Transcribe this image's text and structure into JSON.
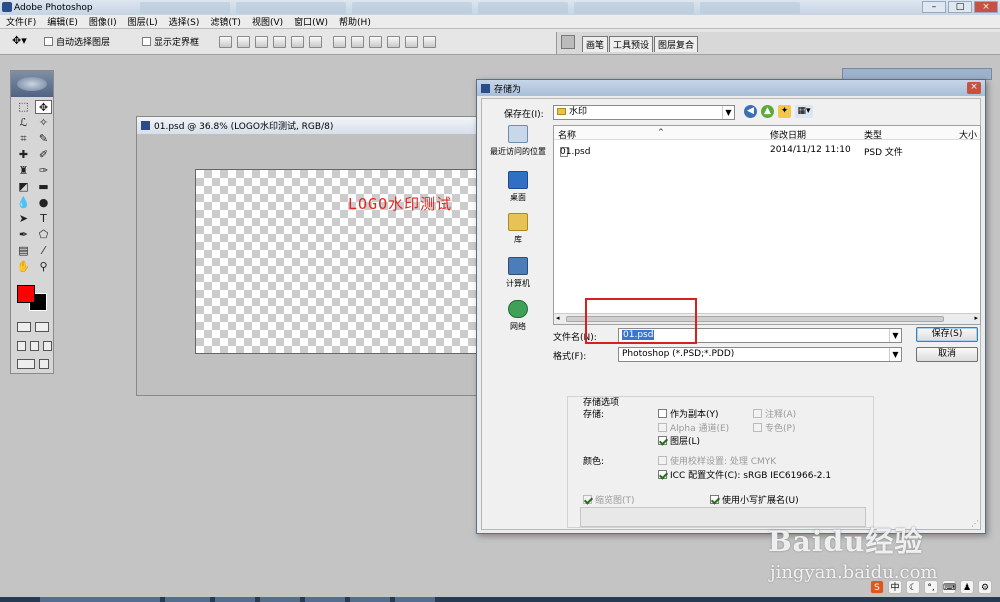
{
  "app": {
    "title": "Adobe Photoshop"
  },
  "menu": [
    "文件(F)",
    "编辑(E)",
    "图像(I)",
    "图层(L)",
    "选择(S)",
    "滤镜(T)",
    "视图(V)",
    "窗口(W)",
    "帮助(H)"
  ],
  "options_bar": {
    "tool_icon": "move-tool",
    "auto_select_label": "自动选择图层",
    "show_bounds_label": "显示定界框"
  },
  "palette_tabs": [
    "画笔",
    "工具预设",
    "图层复合"
  ],
  "colors": {
    "foreground": "#ff0000",
    "background": "#000000"
  },
  "document": {
    "title": "01.psd @ 36.8% (LOGO水印测试, RGB/8)",
    "watermark_text": "LOGO水印测试"
  },
  "dialog": {
    "title": "存储为",
    "save_in_label": "保存在(I):",
    "save_in_value": "水印",
    "places": [
      "最近访问的位置",
      "桌面",
      "库",
      "计算机",
      "网络"
    ],
    "columns": [
      "名称",
      "修改日期",
      "类型",
      "大小"
    ],
    "files": [
      {
        "name": "01.psd",
        "date": "2014/11/12 11:10",
        "type": "PSD 文件"
      }
    ],
    "filename_label": "文件名(N):",
    "filename_value": "01.psd",
    "format_label": "格式(F):",
    "format_value": "Photoshop (*.PSD;*.PDD)",
    "save_button": "保存(S)",
    "cancel_button": "取消",
    "save_options_title": "存储选项",
    "storage_label": "存储:",
    "options": {
      "as_copy": "作为副本(Y)",
      "notes": "注释(A)",
      "alpha": "Alpha 通道(E)",
      "spot": "专色(P)",
      "layers": "图层(L)"
    },
    "color_label": "颜色:",
    "proof_setup": "使用校样设置: 处理 CMYK",
    "icc_profile": "ICC 配置文件(C): sRGB IEC61966-2.1",
    "thumbnail": "缩览图(T)",
    "lowercase_ext": "使用小写扩展名(U)"
  },
  "watermark_site": {
    "brand": "Baidu经验",
    "url": "jingyan.baidu.com"
  },
  "tray": {
    "ime": "S",
    "lang": "中"
  }
}
